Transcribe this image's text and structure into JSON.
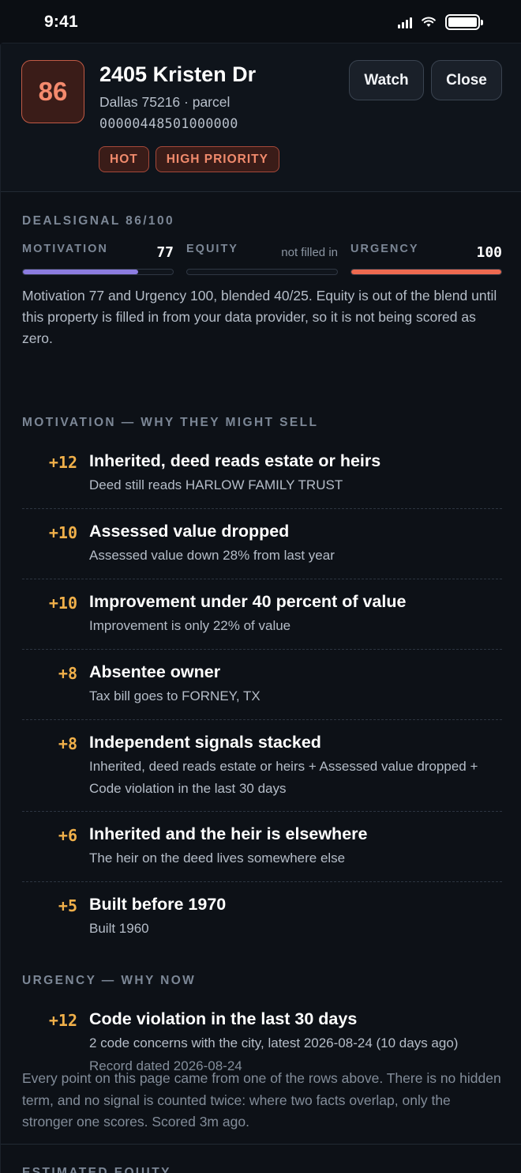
{
  "status_bar": {
    "time": "9:41"
  },
  "header": {
    "score": "86",
    "address": "2405 Kristen Dr",
    "city_line": "Dallas 75216 · parcel",
    "parcel_id": "00000448501000000",
    "tags": [
      "HOT",
      "HIGH PRIORITY"
    ],
    "watch_label": "Watch",
    "close_label": "Close"
  },
  "dealsignal": {
    "label": "DEALSIGNAL 86/100",
    "motivation": {
      "label": "MOTIVATION",
      "value": "77",
      "level": 0.77,
      "color": "#8c7ce0"
    },
    "equity": {
      "label": "EQUITY",
      "note": "not filled in",
      "level": 0
    },
    "urgency": {
      "label": "URGENCY",
      "value": "100",
      "level": 1.0,
      "color": "#ee6a50"
    },
    "blend_text": "Motivation 77 and Urgency 100, blended 40/25. Equity is out of the blend until this property is filled in from your data provider, so it is not being scored as zero."
  },
  "motivation_section": {
    "label": "MOTIVATION — WHY THEY MIGHT SELL",
    "items": [
      {
        "points": "+12",
        "title": "Inherited, deed reads estate or heirs",
        "detail": "Deed still reads HARLOW FAMILY TRUST"
      },
      {
        "points": "+10",
        "title": "Assessed value dropped",
        "detail": "Assessed value down 28% from last year"
      },
      {
        "points": "+10",
        "title": "Improvement under 40 percent of value",
        "detail": "Improvement is only 22% of value"
      },
      {
        "points": "+8",
        "title": "Absentee owner",
        "detail": "Tax bill goes to FORNEY, TX"
      },
      {
        "points": "+8",
        "title": "Independent signals stacked",
        "detail": "Inherited, deed reads estate or heirs + Assessed value dropped + Code violation in the last 30 days"
      },
      {
        "points": "+6",
        "title": "Inherited and the heir is elsewhere",
        "detail": "The heir on the deed lives somewhere else"
      },
      {
        "points": "+5",
        "title": "Built before 1970",
        "detail": "Built 1960"
      }
    ]
  },
  "urgency_section": {
    "label": "URGENCY — WHY NOW",
    "items": [
      {
        "points": "+12",
        "title": "Code violation in the last 30 days",
        "detail": "2 code concerns with the city, latest 2026-08-24 (10 days ago)",
        "sub": "Record dated 2026-08-24"
      }
    ]
  },
  "footnote": "Every point on this page came from one of the rows above. There is no hidden term, and no signal is counted twice: where two facts overlap, only the stronger one scores. Scored 3m ago.",
  "next_section_label": "ESTIMATED EQUITY"
}
